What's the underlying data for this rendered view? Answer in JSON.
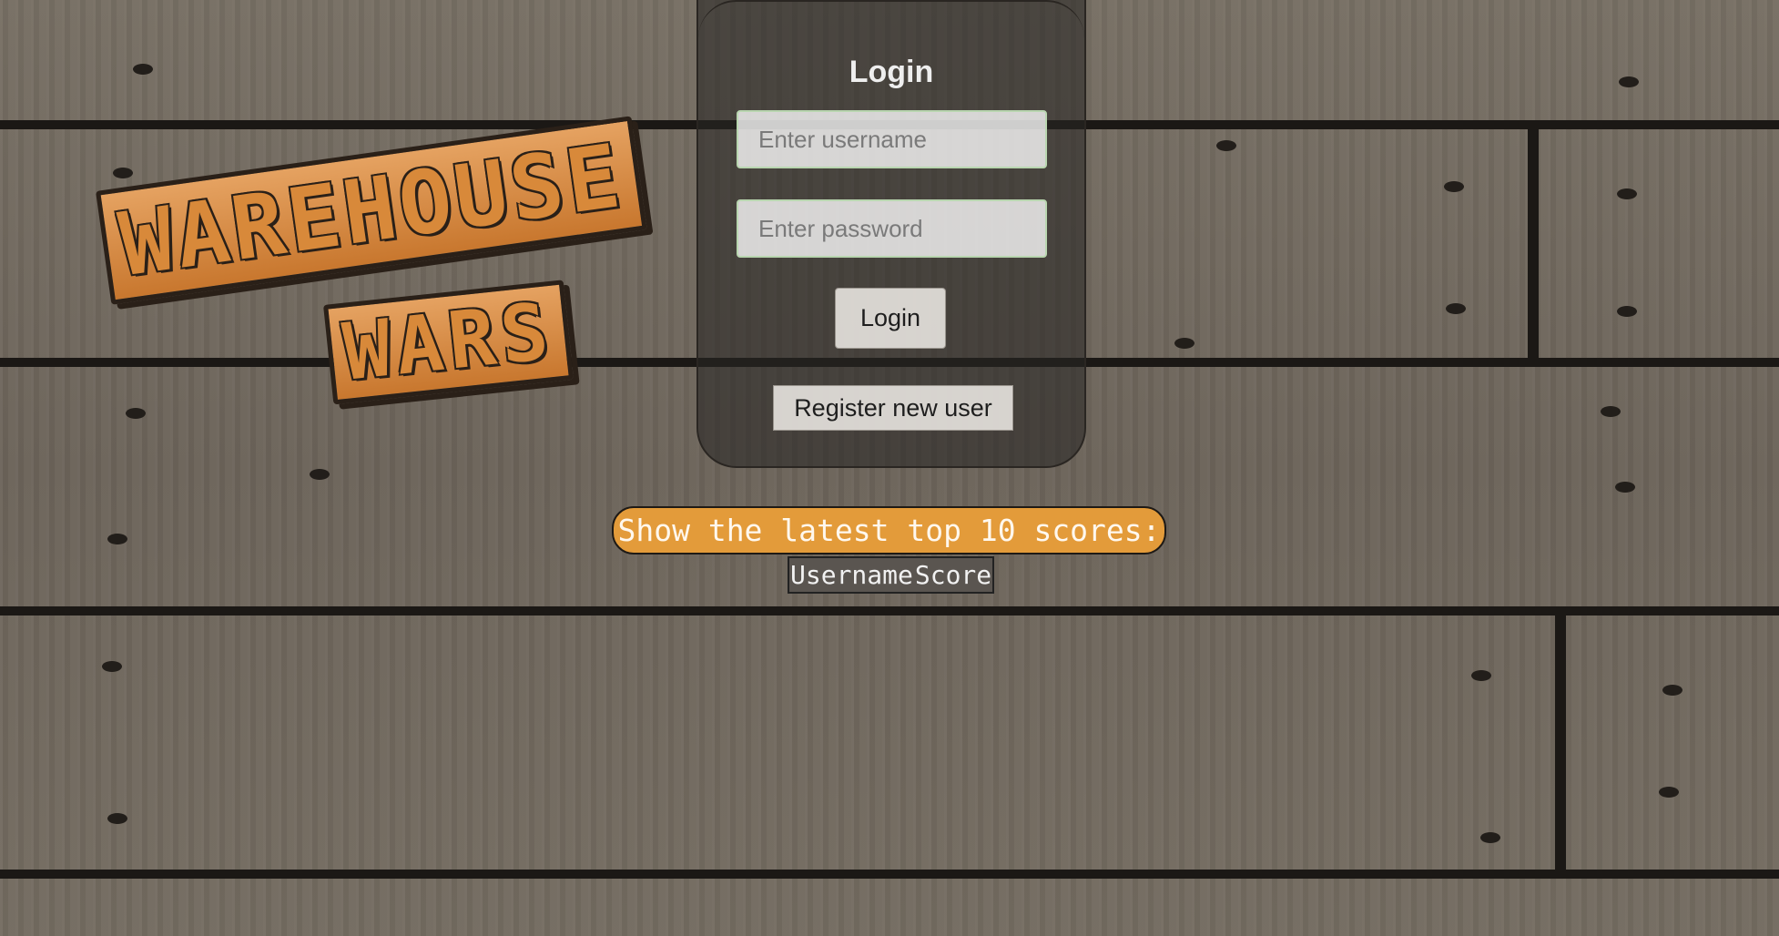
{
  "logo": {
    "line1": "WAREHOUSE",
    "line2": "WARS"
  },
  "login": {
    "title": "Login",
    "username_placeholder": "Enter username",
    "password_placeholder": "Enter password",
    "login_label": "Login",
    "register_label": "Register new user"
  },
  "scores": {
    "button_label": "Show the latest top 10 scores:",
    "headers": [
      "Username",
      "Score"
    ]
  },
  "colors": {
    "accent_orange": "#e39b3a",
    "panel": "#282624",
    "field_border": "#b9d6b0"
  }
}
